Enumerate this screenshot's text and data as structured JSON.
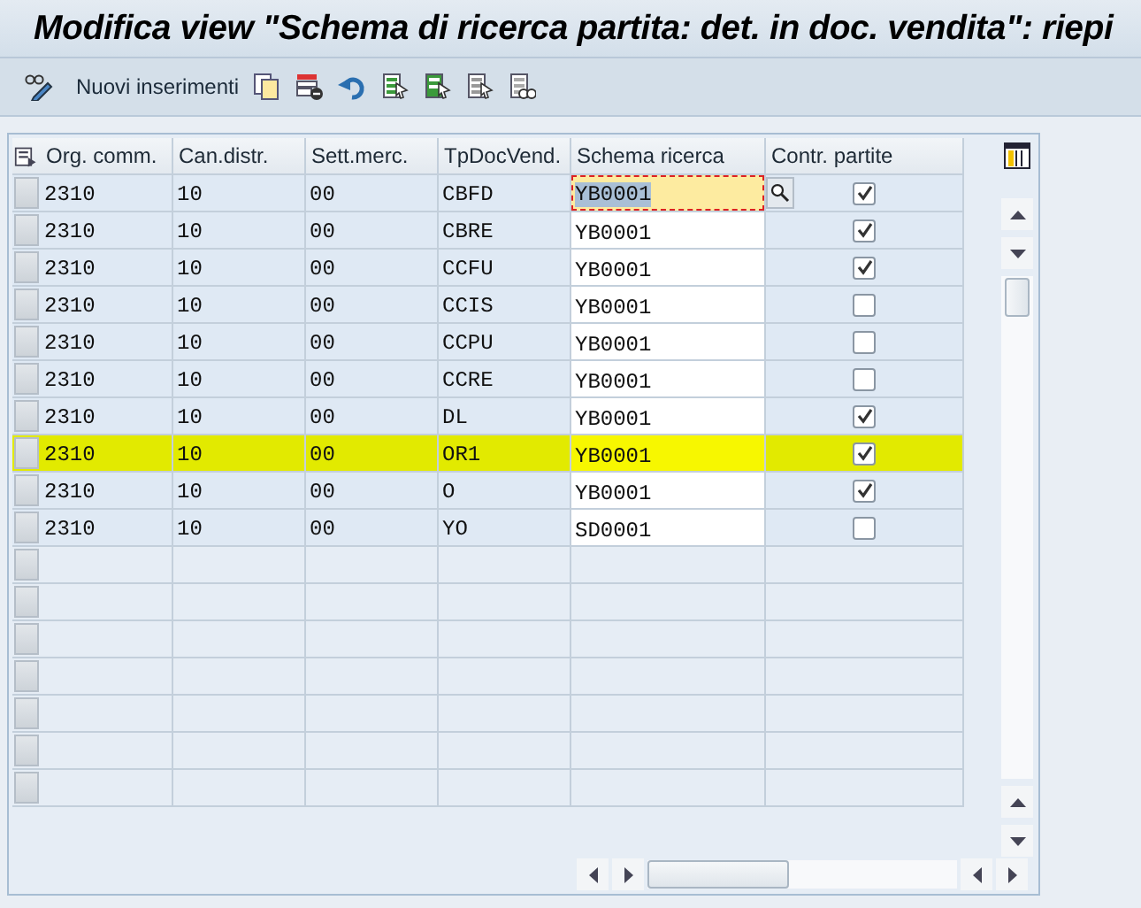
{
  "title": "Modifica view \"Schema di ricerca partita: det. in doc. vendita\": riepi",
  "toolbar": {
    "new_entries": "Nuovi inserimenti"
  },
  "columns": [
    "Org. comm.",
    "Can.distr.",
    "Sett.merc.",
    "TpDocVend.",
    "Schema ricerca",
    "Contr. partite"
  ],
  "rows": [
    {
      "org": "2310",
      "channel": "10",
      "division": "00",
      "doc_type": "CBFD",
      "schema": "YB0001",
      "focused": true,
      "checked": true,
      "highlighted": false
    },
    {
      "org": "2310",
      "channel": "10",
      "division": "00",
      "doc_type": "CBRE",
      "schema": "YB0001",
      "focused": false,
      "checked": true,
      "highlighted": false
    },
    {
      "org": "2310",
      "channel": "10",
      "division": "00",
      "doc_type": "CCFU",
      "schema": "YB0001",
      "focused": false,
      "checked": true,
      "highlighted": false
    },
    {
      "org": "2310",
      "channel": "10",
      "division": "00",
      "doc_type": "CCIS",
      "schema": "YB0001",
      "focused": false,
      "checked": false,
      "highlighted": false
    },
    {
      "org": "2310",
      "channel": "10",
      "division": "00",
      "doc_type": "CCPU",
      "schema": "YB0001",
      "focused": false,
      "checked": false,
      "highlighted": false
    },
    {
      "org": "2310",
      "channel": "10",
      "division": "00",
      "doc_type": "CCRE",
      "schema": "YB0001",
      "focused": false,
      "checked": false,
      "highlighted": false
    },
    {
      "org": "2310",
      "channel": "10",
      "division": "00",
      "doc_type": "DL",
      "schema": "YB0001",
      "focused": false,
      "checked": true,
      "highlighted": false
    },
    {
      "org": "2310",
      "channel": "10",
      "division": "00",
      "doc_type": "OR1",
      "schema": "YB0001",
      "focused": false,
      "checked": true,
      "highlighted": true
    },
    {
      "org": "2310",
      "channel": "10",
      "division": "00",
      "doc_type": "O",
      "schema": "YB0001",
      "focused": false,
      "checked": true,
      "highlighted": false
    },
    {
      "org": "2310",
      "channel": "10",
      "division": "00",
      "doc_type": "YO",
      "schema": "SD0001",
      "focused": false,
      "checked": false,
      "highlighted": false
    }
  ]
}
